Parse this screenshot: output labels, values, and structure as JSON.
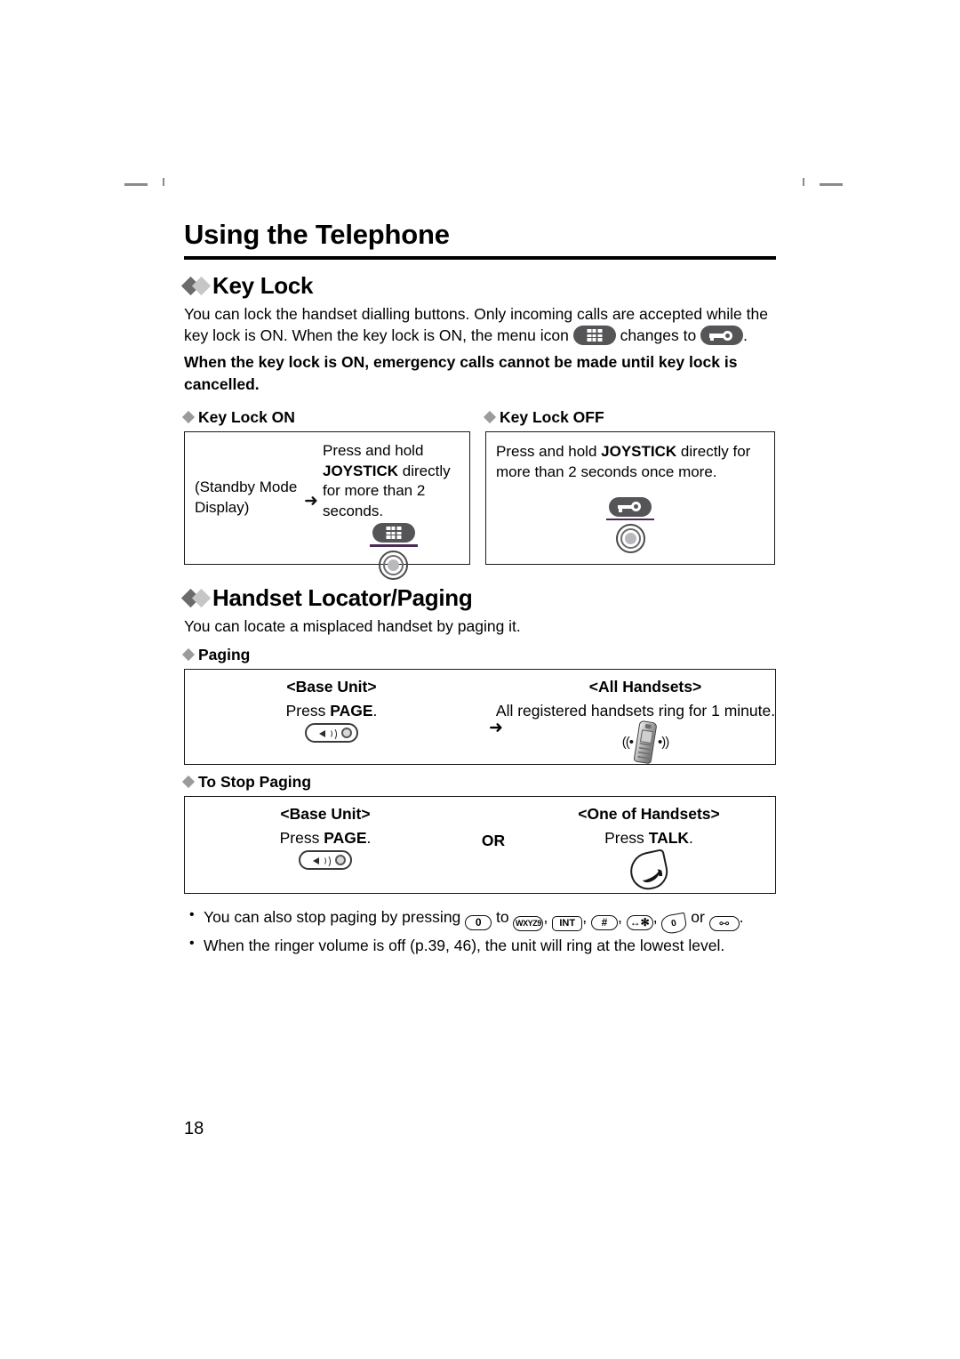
{
  "document": {
    "chapter_title": "Using the Telephone",
    "page_number": "18"
  },
  "key_lock": {
    "heading": "Key Lock",
    "intro_1": "You can lock the handset dialling buttons. Only incoming calls are accepted while the",
    "intro_2a": "key lock is ON. When the key lock is ON, the menu icon",
    "intro_2b": "changes to",
    "intro_2c": ".",
    "warning": "When the key lock is ON, emergency calls cannot be made until key lock is cancelled.",
    "on": {
      "sub_heading": "Key Lock ON",
      "standby_label_line1": "(Standby Mode",
      "standby_label_line2": "Display)",
      "arrow": "➜",
      "instruction_1": "Press and hold",
      "instruction_bold": "JOYSTICK",
      "instruction_2": " directly",
      "instruction_3": "for more than 2",
      "instruction_4": "seconds.",
      "icon_menu": "menu-grid-icon",
      "icon_joystick": "joystick-icon"
    },
    "off": {
      "sub_heading": "Key Lock OFF",
      "instruction_1": "Press and hold ",
      "instruction_bold": "JOYSTICK",
      "instruction_2": " directly for",
      "instruction_3": "more than 2 seconds once more.",
      "icon_key": "key-lock-icon",
      "icon_joystick": "joystick-icon"
    }
  },
  "handset_locator": {
    "heading": "Handset Locator/Paging",
    "intro": "You can locate a misplaced handset by paging it.",
    "paging": {
      "sub_heading": "Paging",
      "base_unit_header": "<Base Unit>",
      "base_unit_press": "Press ",
      "base_unit_press_bold": "PAGE",
      "base_unit_press_end": ".",
      "arrow": "➜",
      "all_handsets_header": "<All Handsets>",
      "all_handsets_text": "All registered handsets ring for 1 minute.",
      "icon_page_button": "page-button-icon",
      "icon_handset_ringing": "handset-ringing-icon"
    },
    "stop_paging": {
      "sub_heading": "To Stop Paging",
      "base_unit_header": "<Base Unit>",
      "base_unit_press": "Press ",
      "base_unit_press_bold": "PAGE",
      "base_unit_press_end": ".",
      "or_label": "OR",
      "one_handset_header": "<One of Handsets>",
      "one_handset_press": "Press ",
      "one_handset_press_bold": "TALK",
      "one_handset_press_end": ".",
      "icon_page_button": "page-button-icon",
      "icon_talk_button": "talk-button-icon"
    },
    "notes": {
      "note1_a": "You can also stop paging by pressing ",
      "note1_to": " to ",
      "note1_or": " or ",
      "note1_end": ".",
      "note2": "When the ringer volume is off (p.39, 46), the unit will ring at the lowest level.",
      "keys": {
        "zero": "0",
        "nine_prefix": "WXYZ",
        "nine": "9",
        "int": "INT",
        "hash": "#",
        "star": "∗",
        "off": "0",
        "speaker": "⧟"
      }
    }
  },
  "colors": {
    "icon_dark": "#555558",
    "diamond_dark": "#6b6b6b",
    "diamond_light": "#c6c6c6",
    "underline_purple": "#4b2a55"
  }
}
